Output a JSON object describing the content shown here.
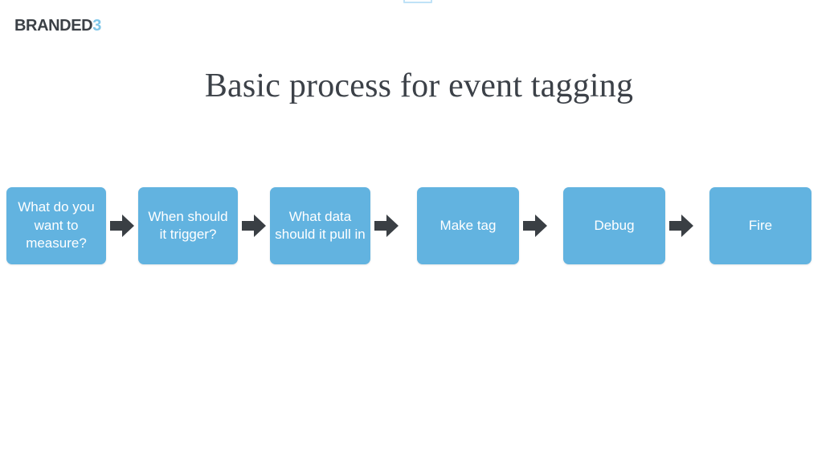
{
  "slide": {
    "background_color": "#ffffff",
    "title": "Basic process for event tagging",
    "title_color": "#3c4148"
  },
  "logo": {
    "name": "branded3-logo",
    "word": "BRANDED",
    "word_color": "#3b4046",
    "number": "3",
    "number_color": "#7ec5e8"
  },
  "artifact": {
    "name": "cropped-rectangle-outline",
    "color": "#bfe2f7"
  },
  "flow": {
    "box_color": "#62b3e0",
    "box_text_color": "#ffffff",
    "arrow_color": "#3a3f44",
    "arrow_glyph": "right-block-arrow",
    "steps": [
      {
        "label": "What do you want to measure?",
        "icon": "process-box"
      },
      {
        "label": "When should it trigger?",
        "icon": "process-box"
      },
      {
        "label": "What data should it pull in",
        "icon": "process-box"
      },
      {
        "label": "Make tag",
        "icon": "process-box"
      },
      {
        "label": "Debug",
        "icon": "process-box"
      },
      {
        "label": "Fire",
        "icon": "process-box"
      }
    ],
    "arrow_count": 5
  }
}
